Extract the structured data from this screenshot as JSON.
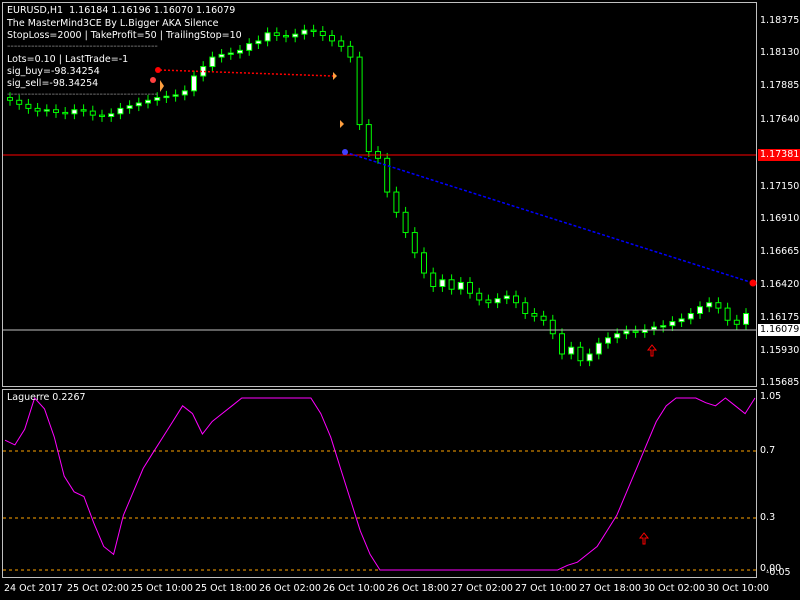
{
  "header": {
    "symbol_line": "EURUSD,H1  1.16184 1.16196 1.16070 1.16079",
    "ea_name": "The MasterMind3CE By L.Bigger AKA Silence",
    "params": "StopLoss=2000 | TakeProfit=50 | TrailingStop=10",
    "divider": "--------------------------------------------",
    "lots": "Lots=0.10 | LastTrade=-1",
    "sig_buy": "sig_buy=-98.34254",
    "sig_sell": "sig_sell=-98.34254",
    "divider2": "--------------------------------------------"
  },
  "price_axis": {
    "labels": [
      "1.18375",
      "1.18130",
      "1.17885",
      "1.17640",
      "1.17150",
      "1.16910",
      "1.16665",
      "1.16420",
      "1.16175",
      "1.15930",
      "1.15685"
    ],
    "red_level": "1.17381",
    "current_price": "1.16079"
  },
  "time_axis": {
    "labels": [
      "24 Oct 2017",
      "25 Oct 02:00",
      "25 Oct 10:00",
      "25 Oct 18:00",
      "26 Oct 02:00",
      "26 Oct 10:00",
      "26 Oct 18:00",
      "27 Oct 02:00",
      "27 Oct 10:00",
      "27 Oct 18:00",
      "30 Oct 02:00",
      "30 Oct 10:00"
    ]
  },
  "indicator": {
    "title": "Laguerre 0.2267",
    "levels": [
      "1.05",
      "0.7",
      "0.3",
      "0.00",
      "-0.05"
    ]
  },
  "colors": {
    "bull_candle": "#ffffff",
    "bear_candle": "#000000",
    "wick": "#00ff00",
    "red_line": "#ff0000",
    "current_line": "#c0c0c0",
    "laguerre_line": "#ff00ff",
    "indicator_level": "#ffa500",
    "trade_sell_line": "#ff0000",
    "trade_buy_line": "#0000ff"
  },
  "chart_data": {
    "type": "candlestick",
    "ohlc_approx_close": [
      1.1778,
      1.1775,
      1.1772,
      1.177,
      1.1771,
      1.1769,
      1.1768,
      1.1771,
      1.177,
      1.1767,
      1.1766,
      1.1768,
      1.1772,
      1.1774,
      1.1776,
      1.1778,
      1.178,
      1.1781,
      1.1782,
      1.1785,
      1.1796,
      1.1803,
      1.181,
      1.1812,
      1.1813,
      1.1815,
      1.182,
      1.1822,
      1.1828,
      1.1826,
      1.1825,
      1.1827,
      1.183,
      1.1829,
      1.1826,
      1.1822,
      1.1818,
      1.181,
      1.176,
      1.174,
      1.1735,
      1.171,
      1.1695,
      1.168,
      1.1665,
      1.165,
      1.164,
      1.1645,
      1.1638,
      1.1643,
      1.1635,
      1.163,
      1.1628,
      1.1631,
      1.1633,
      1.1628,
      1.162,
      1.1618,
      1.1615,
      1.1605,
      1.159,
      1.1595,
      1.1585,
      1.159,
      1.1598,
      1.1602,
      1.1605,
      1.1607,
      1.1606,
      1.1608,
      1.161,
      1.1611,
      1.1614,
      1.1616,
      1.162,
      1.1625,
      1.1628,
      1.1624,
      1.1615,
      1.1612,
      1.162
    ],
    "laguerre": [
      0.78,
      0.75,
      0.85,
      1.05,
      0.98,
      0.8,
      0.55,
      0.45,
      0.42,
      0.25,
      0.1,
      0.05,
      0.3,
      0.45,
      0.6,
      0.7,
      0.8,
      0.9,
      1.0,
      0.95,
      0.82,
      0.9,
      0.95,
      1.0,
      1.05,
      1.05,
      1.05,
      1.05,
      1.05,
      1.05,
      1.05,
      1.05,
      0.95,
      0.8,
      0.6,
      0.4,
      0.2,
      0.05,
      -0.05,
      -0.05,
      -0.05,
      -0.05,
      -0.05,
      -0.05,
      -0.05,
      -0.05,
      -0.05,
      -0.05,
      -0.05,
      -0.05,
      -0.05,
      -0.05,
      -0.05,
      -0.05,
      -0.05,
      -0.05,
      -0.05,
      -0.02,
      0.0,
      0.05,
      0.1,
      0.2,
      0.3,
      0.45,
      0.6,
      0.75,
      0.9,
      1.0,
      1.05,
      1.05,
      1.05,
      1.02,
      1.0,
      1.05,
      1.0,
      0.95,
      1.05
    ]
  }
}
